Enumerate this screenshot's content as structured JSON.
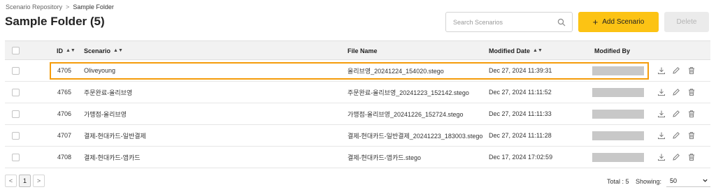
{
  "breadcrumb": {
    "root": "Scenario Repository",
    "separator": ">",
    "current": "Sample Folder"
  },
  "page_title": "Sample Folder (5)",
  "search": {
    "placeholder": "Search Scenarios"
  },
  "toolbar": {
    "add_label": "Add Scenario",
    "add_icon": "+",
    "delete_label": "Delete"
  },
  "columns": {
    "id": "ID",
    "scenario": "Scenario",
    "file_name": "File Name",
    "modified_date": "Modified Date",
    "modified_by": "Modified By",
    "sort_icon": "▲▼"
  },
  "rows": [
    {
      "id": "4705",
      "scenario": "Oliveyoung",
      "file_name": "올리브영_20241224_154020.stego",
      "modified_date": "Dec 27, 2024 11:39:31"
    },
    {
      "id": "4765",
      "scenario": "주문완료-올리브영",
      "file_name": "주문완료-올리브영_20241223_152142.stego",
      "modified_date": "Dec 27, 2024 11:11:52"
    },
    {
      "id": "4706",
      "scenario": "가맹점-올리브영",
      "file_name": "가맹점-올리브영_20241226_152724.stego",
      "modified_date": "Dec 27, 2024 11:11:33"
    },
    {
      "id": "4707",
      "scenario": "결제-현대카드-일반결제",
      "file_name": "결제-현대카드-일반결제_20241223_183003.stego",
      "modified_date": "Dec 27, 2024 11:11:28"
    },
    {
      "id": "4708",
      "scenario": "결제-현대카드-앱카드",
      "file_name": "결제-현대카드-앱카드.stego",
      "modified_date": "Dec 17, 2024 17:02:59"
    }
  ],
  "pagination": {
    "prev": "<",
    "current_page": "1",
    "next": ">"
  },
  "footer": {
    "total": "Total : 5",
    "showing_label": "Showing:",
    "showing_value": "50"
  },
  "colors": {
    "accent": "#fcc314",
    "highlight": "#f59c0b",
    "header_bg": "#f2f2f2"
  }
}
